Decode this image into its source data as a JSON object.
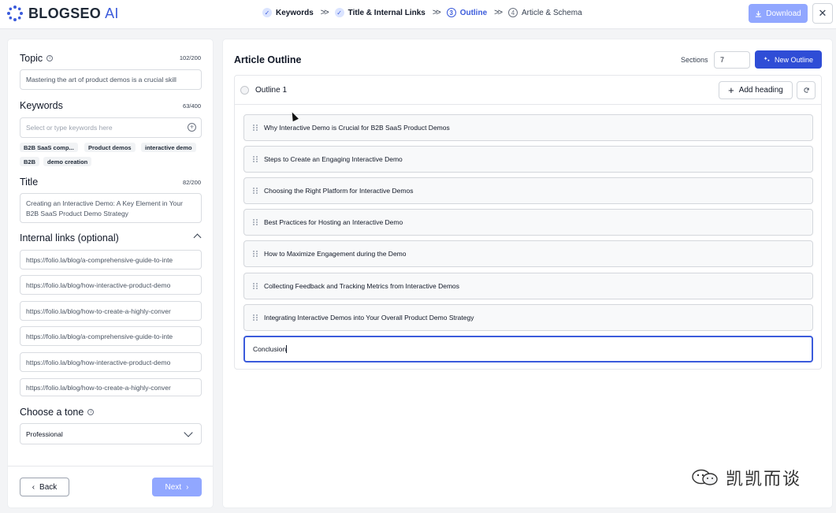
{
  "app": {
    "brand": "BLOGSEO",
    "brand_suffix": "AI"
  },
  "steps": [
    {
      "badge": "✓",
      "label": "Keywords",
      "state": "done"
    },
    {
      "badge": "✓",
      "label": "Title & Internal Links",
      "state": "done"
    },
    {
      "badge": "3",
      "label": "Outline",
      "state": "active"
    },
    {
      "badge": "4",
      "label": "Article & Schema",
      "state": "todo"
    }
  ],
  "step_separator": ">>",
  "header": {
    "download_label": "Download",
    "close_symbol": "✕"
  },
  "left": {
    "topic": {
      "label": "Topic",
      "counter": "102/200",
      "value": "Mastering the art of product demos is a crucial skill"
    },
    "keywords": {
      "label": "Keywords",
      "counter": "63/400",
      "placeholder": "Select or type keywords here",
      "chips": [
        "B2B SaaS comp...",
        "Product demos",
        "interactive demo",
        "B2B",
        "demo creation"
      ]
    },
    "title": {
      "label": "Title",
      "counter": "82/200",
      "value": "Creating an Interactive Demo: A Key Element in Your B2B SaaS Product Demo Strategy"
    },
    "internal_links": {
      "label": "Internal links (optional)",
      "links": [
        "https://folio.la/blog/a-comprehensive-guide-to-inte",
        "https://folio.la/blog/how-interactive-product-demo",
        "https://folio.la/blog/how-to-create-a-highly-conver",
        "https://folio.la/blog/a-comprehensive-guide-to-inte",
        "https://folio.la/blog/how-interactive-product-demo",
        "https://folio.la/blog/how-to-create-a-highly-conver"
      ]
    },
    "tone": {
      "label": "Choose a tone",
      "value": "Professional"
    },
    "back_label": "Back",
    "next_label": "Next"
  },
  "right": {
    "title": "Article Outline",
    "sections_label": "Sections",
    "sections_value": "7",
    "new_outline_label": "New Outline",
    "outline_name": "Outline 1",
    "add_heading_label": "Add heading",
    "headings": [
      "Why Interactive Demo is Crucial for B2B SaaS Product Demos",
      "Steps to Create an Engaging Interactive Demo",
      "Choosing the Right Platform for Interactive Demos",
      "Best Practices for Hosting an Interactive Demo",
      "How to Maximize Engagement during the Demo",
      "Collecting Feedback and Tracking Metrics from Interactive Demos",
      "Integrating Interactive Demos into Your Overall Product Demo Strategy"
    ],
    "editing_heading": "Conclusion"
  },
  "watermark": {
    "text": "凯凯而谈"
  },
  "colors": {
    "accent": "#2f4dd6",
    "accent_light": "#91a7ff",
    "active_step": "#3b5bdb"
  }
}
